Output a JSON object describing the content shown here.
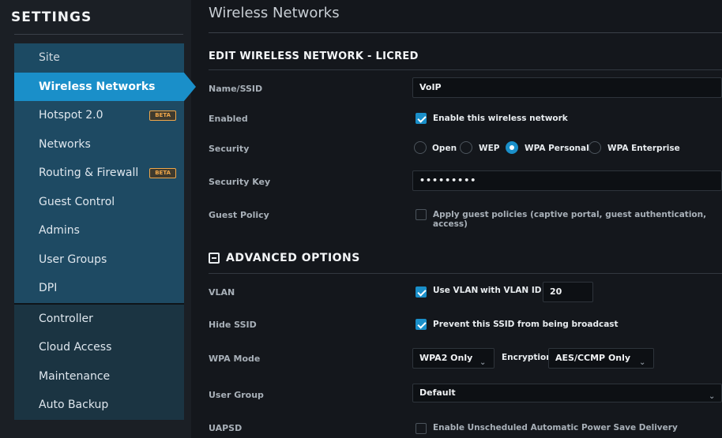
{
  "sidebar": {
    "title": "SETTINGS",
    "items": [
      {
        "label": "Site"
      },
      {
        "label": "Wireless Networks"
      },
      {
        "label": "Hotspot 2.0",
        "badge": "BETA"
      },
      {
        "label": "Networks"
      },
      {
        "label": "Routing & Firewall",
        "badge": "BETA"
      },
      {
        "label": "Guest Control"
      },
      {
        "label": "Admins"
      },
      {
        "label": "User Groups"
      },
      {
        "label": "DPI"
      },
      {
        "label": "Controller"
      },
      {
        "label": "Cloud Access"
      },
      {
        "label": "Maintenance"
      },
      {
        "label": "Auto Backup"
      }
    ]
  },
  "page": {
    "title": "Wireless Networks",
    "section_title": "EDIT WIRELESS NETWORK - LICRED"
  },
  "form": {
    "ssid": {
      "label": "Name/SSID",
      "value": "VoIP"
    },
    "enabled": {
      "label": "Enabled",
      "option": "Enable this wireless network",
      "checked": true
    },
    "security": {
      "label": "Security",
      "options": [
        "Open",
        "WEP",
        "WPA Personal",
        "WPA Enterprise"
      ],
      "selected": "WPA Personal"
    },
    "security_key": {
      "label": "Security Key",
      "value": "•••••••••"
    },
    "guest_policy": {
      "label": "Guest Policy",
      "option": "Apply guest policies (captive portal, guest authentication, access)",
      "checked": false
    }
  },
  "advanced": {
    "title": "ADVANCED OPTIONS",
    "vlan": {
      "label": "VLAN",
      "option": "Use VLAN",
      "with_label": "with VLAN ID",
      "vlan_id": "20",
      "checked": true
    },
    "hide_ssid": {
      "label": "Hide SSID",
      "option": "Prevent this SSID from being broadcast",
      "checked": true
    },
    "wpa_mode": {
      "label": "WPA Mode",
      "value": "WPA2 Only",
      "encryption_label": "Encryption",
      "encryption_value": "AES/CCMP Only"
    },
    "user_group": {
      "label": "User Group",
      "value": "Default"
    },
    "uapsd": {
      "label": "UAPSD",
      "option": "Enable Unscheduled Automatic Power Save Delivery",
      "checked": false
    }
  },
  "colors": {
    "accent": "#1a8fc9",
    "beta": "#f0a74a",
    "sidebar_item": "#1e4a63"
  }
}
